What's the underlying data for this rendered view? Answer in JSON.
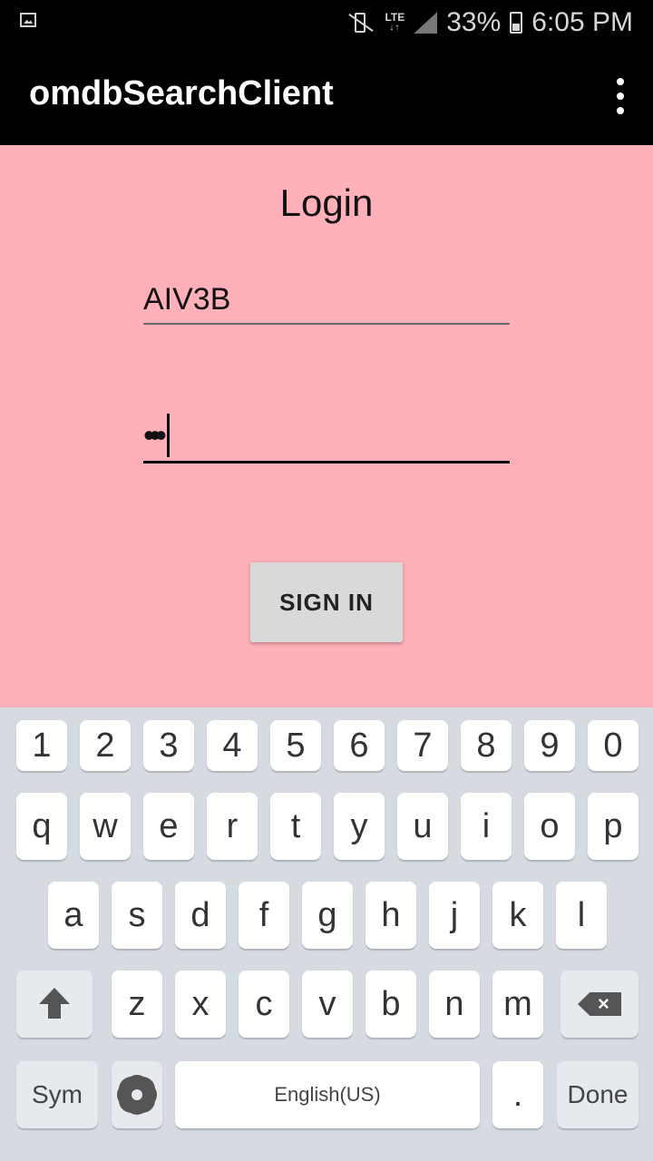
{
  "status_bar": {
    "signal_text": "LTE",
    "battery": "33%",
    "time": "6:05 PM"
  },
  "app_bar": {
    "title": "omdbSearchClient"
  },
  "login": {
    "title": "Login",
    "username_value": "AIV3B",
    "password_value": "•••",
    "sign_in_label": "SIGN IN"
  },
  "keyboard": {
    "row_numbers": [
      "1",
      "2",
      "3",
      "4",
      "5",
      "6",
      "7",
      "8",
      "9",
      "0"
    ],
    "row_q": [
      "q",
      "w",
      "e",
      "r",
      "t",
      "y",
      "u",
      "i",
      "o",
      "p"
    ],
    "row_a": [
      "a",
      "s",
      "d",
      "f",
      "g",
      "h",
      "j",
      "k",
      "l"
    ],
    "row_z": [
      "z",
      "x",
      "c",
      "v",
      "b",
      "n",
      "m"
    ],
    "sym_label": "Sym",
    "space_label": "English(US)",
    "period_label": ".",
    "done_label": "Done"
  },
  "colors": {
    "content_background": "#ffb0b9",
    "app_bar_background": "#000000",
    "keyboard_background": "#d6dbe2"
  }
}
